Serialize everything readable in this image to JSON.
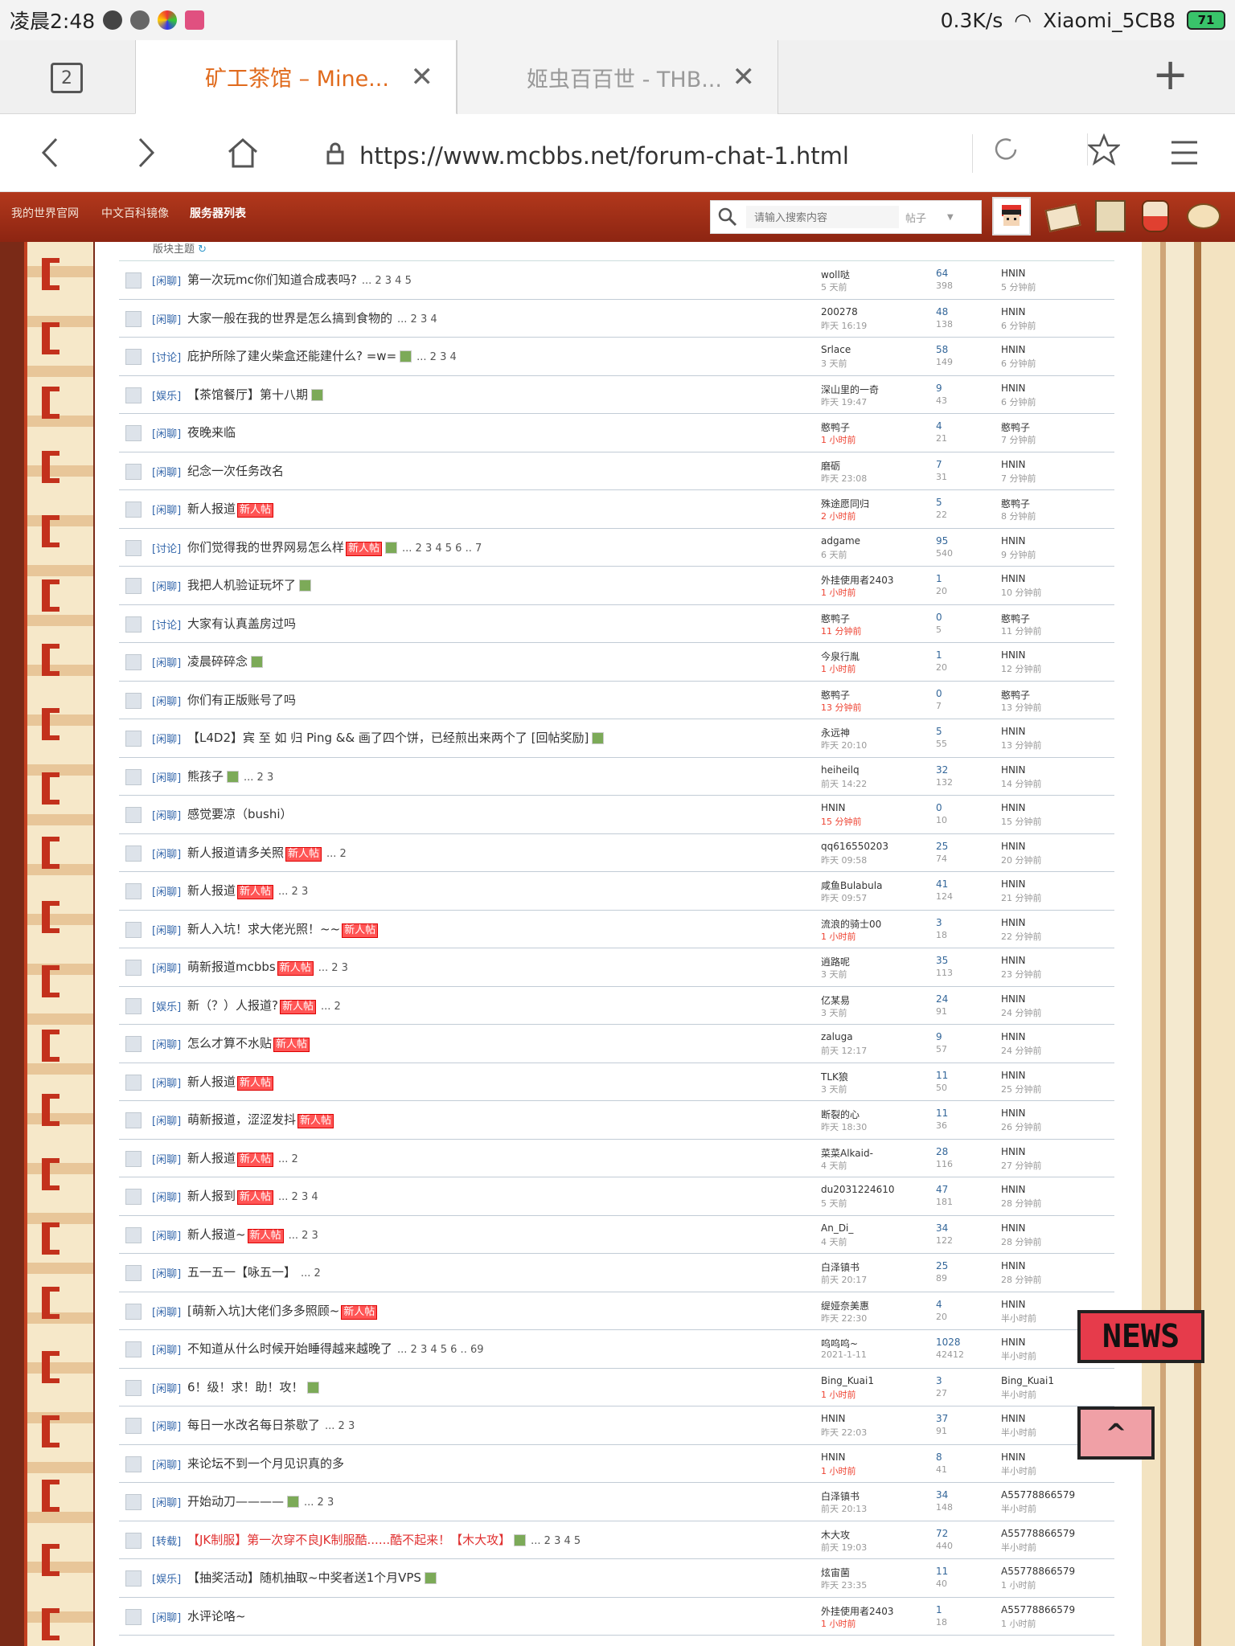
{
  "status": {
    "time": "凌晨2:48",
    "speed": "0.3K/s",
    "wifi": "Xiaomi_5CB8",
    "battery": "71"
  },
  "browser": {
    "tab_count": "2",
    "tabs": [
      {
        "title": "矿工茶馆 – Mine...",
        "close": "✕"
      },
      {
        "title": "姬虫百百世 - THB...",
        "close": "✕"
      }
    ],
    "new_tab": "+",
    "url": "https://www.mcbbs.net/forum-chat-1.html"
  },
  "sitenav": {
    "items": [
      "我的世界官网",
      "中文百科镜像",
      "服务器列表"
    ],
    "search_placeholder": "请输入搜索内容",
    "search_type": "帖子"
  },
  "forum": {
    "header": "版块主题",
    "threads": [
      {
        "cat": "[闲聊]",
        "title": "第一次玩mc你们知道合成表吗?",
        "extra": "",
        "pages": "... 2 3 4 5",
        "author": "woll哒",
        "atime": "5 天前",
        "replies": "64",
        "views": "398",
        "last": "HNIN",
        "ltime": "5 分钟前"
      },
      {
        "cat": "[闲聊]",
        "title": "大家一般在我的世界是怎么搞到食物的",
        "extra": "",
        "pages": "... 2 3 4",
        "author": "200278",
        "atime": "昨天 16:19",
        "replies": "48",
        "views": "138",
        "last": "HNIN",
        "ltime": "6 分钟前"
      },
      {
        "cat": "[讨论]",
        "title": "庇护所除了建火柴盒还能建什么? =w=",
        "extra": "img",
        "pages": "... 2 3 4",
        "author": "Srlace",
        "atime": "3 天前",
        "replies": "58",
        "views": "149",
        "last": "HNIN",
        "ltime": "6 分钟前"
      },
      {
        "cat": "[娱乐]",
        "title": "【茶馆餐厅】第十八期",
        "extra": "img",
        "pages": "",
        "author": "深山里的一奇",
        "atime": "昨天 19:47",
        "replies": "9",
        "views": "43",
        "last": "HNIN",
        "ltime": "6 分钟前"
      },
      {
        "cat": "[闲聊]",
        "title": "夜晚来临",
        "extra": "",
        "pages": "",
        "author": "憨鸭子",
        "atime": "1 小时前",
        "red": true,
        "replies": "4",
        "views": "21",
        "last": "憨鸭子",
        "ltime": "7 分钟前"
      },
      {
        "cat": "[闲聊]",
        "title": "纪念一次任务改名",
        "extra": "",
        "pages": "",
        "author": "磨砺",
        "atime": "昨天 23:08",
        "replies": "7",
        "views": "31",
        "last": "HNIN",
        "ltime": "7 分钟前"
      },
      {
        "cat": "[闲聊]",
        "title": "新人报道",
        "extra": "badge",
        "pages": "",
        "author": "殊途愿同归",
        "atime": "2 小时前",
        "red": true,
        "replies": "5",
        "views": "22",
        "last": "憨鸭子",
        "ltime": "8 分钟前"
      },
      {
        "cat": "[讨论]",
        "title": "你们觉得我的世界网易怎么样",
        "extra": "badge img",
        "pages": "... 2 3 4 5 6 .. 7",
        "author": "adgame",
        "atime": "6 天前",
        "replies": "95",
        "views": "540",
        "last": "HNIN",
        "ltime": "9 分钟前"
      },
      {
        "cat": "[闲聊]",
        "title": "我把人机验证玩坏了",
        "extra": "img",
        "pages": "",
        "author": "外挂使用者2403",
        "atime": "1 小时前",
        "red": true,
        "replies": "1",
        "views": "20",
        "last": "HNIN",
        "ltime": "10 分钟前"
      },
      {
        "cat": "[讨论]",
        "title": "大家有认真盖房过吗",
        "extra": "",
        "pages": "",
        "author": "憨鸭子",
        "atime": "11 分钟前",
        "red": true,
        "replies": "0",
        "views": "5",
        "last": "憨鸭子",
        "ltime": "11 分钟前"
      },
      {
        "cat": "[闲聊]",
        "title": "凌晨碎碎念",
        "extra": "img",
        "pages": "",
        "author": "今泉行胤",
        "atime": "1 小时前",
        "red": true,
        "replies": "1",
        "views": "20",
        "last": "HNIN",
        "ltime": "12 分钟前"
      },
      {
        "cat": "[闲聊]",
        "title": "你们有正版账号了吗",
        "extra": "",
        "pages": "",
        "author": "憨鸭子",
        "atime": "13 分钟前",
        "red": true,
        "replies": "0",
        "views": "7",
        "last": "憨鸭子",
        "ltime": "13 分钟前"
      },
      {
        "cat": "[闲聊]",
        "title": "【L4D2】宾 至 如 归 Ping && 画了四个饼，已经煎出来两个了 [回帖奖励]",
        "extra": "img",
        "pages": "",
        "author": "永远神",
        "atime": "昨天 20:10",
        "replies": "5",
        "views": "55",
        "last": "HNIN",
        "ltime": "13 分钟前"
      },
      {
        "cat": "[闲聊]",
        "title": "熊孩子",
        "extra": "img",
        "pages": "... 2 3",
        "author": "heiheilq",
        "atime": "前天 14:22",
        "replies": "32",
        "views": "132",
        "last": "HNIN",
        "ltime": "14 分钟前"
      },
      {
        "cat": "[闲聊]",
        "title": "感觉要凉（bushi）",
        "extra": "",
        "pages": "",
        "author": "HNIN",
        "atime": "15 分钟前",
        "red": true,
        "replies": "0",
        "views": "10",
        "last": "HNIN",
        "ltime": "15 分钟前"
      },
      {
        "cat": "[闲聊]",
        "title": "新人报道请多关照",
        "extra": "badge",
        "pages": "... 2",
        "author": "qq616550203",
        "atime": "昨天 09:58",
        "replies": "25",
        "views": "74",
        "last": "HNIN",
        "ltime": "20 分钟前"
      },
      {
        "cat": "[闲聊]",
        "title": "新人报道",
        "extra": "badge",
        "pages": "... 2 3",
        "author": "咸鱼Bulabula",
        "atime": "昨天 09:57",
        "replies": "41",
        "views": "124",
        "last": "HNIN",
        "ltime": "21 分钟前"
      },
      {
        "cat": "[闲聊]",
        "title": "新人入坑！求大佬光照！~~",
        "extra": "badge",
        "pages": "",
        "author": "流浪的骑士00",
        "atime": "1 小时前",
        "red": true,
        "replies": "3",
        "views": "18",
        "last": "HNIN",
        "ltime": "22 分钟前"
      },
      {
        "cat": "[闲聊]",
        "title": "萌新报道mcbbs",
        "extra": "badge",
        "pages": "... 2 3",
        "author": "逍路呢",
        "atime": "3 天前",
        "replies": "35",
        "views": "113",
        "last": "HNIN",
        "ltime": "23 分钟前"
      },
      {
        "cat": "[娱乐]",
        "title": "新（？）人报道?",
        "extra": "badge",
        "pages": "... 2",
        "author": "亿某易",
        "atime": "3 天前",
        "replies": "24",
        "views": "91",
        "last": "HNIN",
        "ltime": "24 分钟前"
      },
      {
        "cat": "[闲聊]",
        "title": "怎么才算不水贴",
        "extra": "badge",
        "pages": "",
        "author": "zaluga",
        "atime": "前天 12:17",
        "replies": "9",
        "views": "57",
        "last": "HNIN",
        "ltime": "24 分钟前"
      },
      {
        "cat": "[闲聊]",
        "title": "新人报道",
        "extra": "badge",
        "pages": "",
        "author": "TLK狼",
        "atime": "3 天前",
        "replies": "11",
        "views": "50",
        "last": "HNIN",
        "ltime": "25 分钟前"
      },
      {
        "cat": "[闲聊]",
        "title": "萌新报道，涩涩发抖",
        "extra": "badge",
        "pages": "",
        "author": "断裂的心",
        "atime": "昨天 18:30",
        "replies": "11",
        "views": "36",
        "last": "HNIN",
        "ltime": "26 分钟前"
      },
      {
        "cat": "[闲聊]",
        "title": "新人报道",
        "extra": "badge",
        "pages": "... 2",
        "author": "菜菜Alkaid-",
        "atime": "4 天前",
        "replies": "28",
        "views": "116",
        "last": "HNIN",
        "ltime": "27 分钟前"
      },
      {
        "cat": "[闲聊]",
        "title": "新人报到",
        "extra": "badge",
        "pages": "... 2 3 4",
        "author": "du2031224610",
        "atime": "5 天前",
        "replies": "47",
        "views": "181",
        "last": "HNIN",
        "ltime": "28 分钟前"
      },
      {
        "cat": "[闲聊]",
        "title": "新人报道~",
        "extra": "badge",
        "pages": "... 2 3",
        "author": "An_Di_",
        "atime": "4 天前",
        "replies": "34",
        "views": "122",
        "last": "HNIN",
        "ltime": "28 分钟前"
      },
      {
        "cat": "[闲聊]",
        "title": "五一五一【咏五一】",
        "extra": "",
        "pages": "... 2",
        "author": "白泽镇书",
        "atime": "前天 20:17",
        "replies": "25",
        "views": "89",
        "last": "HNIN",
        "ltime": "28 分钟前"
      },
      {
        "cat": "[闲聊]",
        "title": "[萌新入坑]大佬们多多照顾~",
        "extra": "badge",
        "pages": "",
        "author": "缇娅奈美惠",
        "atime": "昨天 22:30",
        "replies": "4",
        "views": "20",
        "last": "HNIN",
        "ltime": "半小时前"
      },
      {
        "cat": "[闲聊]",
        "title": "不知道从什么时候开始睡得越来越晚了",
        "extra": "",
        "pages": "... 2 3 4 5 6 .. 69",
        "author": "呜呜呜~",
        "atime": "2021-1-11",
        "replies": "1028",
        "views": "42412",
        "last": "HNIN",
        "ltime": "半小时前"
      },
      {
        "cat": "[闲聊]",
        "title": "6！级！求！助！攻！",
        "extra": "img",
        "pages": "",
        "author": "Bing_Kuai1",
        "atime": "1 小时前",
        "red": true,
        "replies": "3",
        "views": "27",
        "last": "Bing_Kuai1",
        "ltime": "半小时前"
      },
      {
        "cat": "[闲聊]",
        "title": "每日一水改名每日茶歇了",
        "extra": "",
        "pages": "... 2 3",
        "author": "HNIN",
        "atime": "昨天 22:03",
        "replies": "37",
        "views": "91",
        "last": "HNIN",
        "ltime": "半小时前"
      },
      {
        "cat": "[闲聊]",
        "title": "来论坛不到一个月见识真的多",
        "extra": "",
        "pages": "",
        "author": "HNIN",
        "atime": "1 小时前",
        "red": true,
        "replies": "8",
        "views": "41",
        "last": "HNIN",
        "ltime": "半小时前"
      },
      {
        "cat": "[闲聊]",
        "title": "开始动刀————",
        "extra": "img",
        "pages": "... 2 3",
        "author": "白泽镇书",
        "atime": "前天 20:13",
        "replies": "34",
        "views": "148",
        "last": "A55778866579",
        "ltime": "半小时前"
      },
      {
        "cat": "[转载]",
        "title": "【JK制服】第一次穿不良JK制服酷......酷不起来！【木大攻】",
        "extra": "img",
        "pages": "... 2 3 4 5",
        "author": "木大攻",
        "atime": "前天 19:03",
        "replies": "72",
        "views": "440",
        "last": "A55778866579",
        "ltime": "半小时前",
        "redtitle": true
      },
      {
        "cat": "[娱乐]",
        "title": "【抽奖活动】随机抽取~中奖者送1个月VPS",
        "extra": "img",
        "pages": "",
        "author": "炫宙菌",
        "atime": "昨天 23:35",
        "replies": "11",
        "views": "40",
        "last": "A55778866579",
        "ltime": "1 小时前"
      },
      {
        "cat": "[闲聊]",
        "title": "水评论咯~",
        "extra": "",
        "pages": "",
        "author": "外挂使用者2403",
        "atime": "1 小时前",
        "red": true,
        "replies": "1",
        "views": "18",
        "last": "A55778866579",
        "ltime": "1 小时前"
      }
    ]
  },
  "floating": {
    "news": "NEWS",
    "top": "^"
  }
}
